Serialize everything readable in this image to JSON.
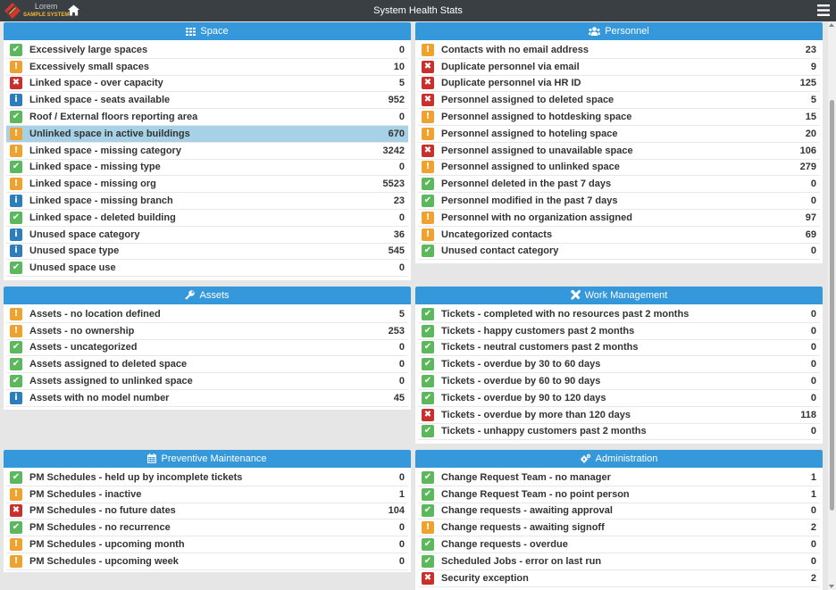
{
  "header": {
    "logo_line1": "Lorem",
    "logo_line2": "SAMPLE SYSTEM",
    "title": "System Health Stats"
  },
  "colors": {
    "ok": "#5cb85c",
    "warn": "#f0a22e",
    "err": "#c9302c",
    "info": "#2b7dbc",
    "panel_header": "#3498db",
    "topbar": "#3a3f44",
    "highlight": "#a7d1e6"
  },
  "panels": {
    "space": {
      "title": "Space",
      "icon": "grid-icon",
      "rows": [
        {
          "label": "Excessively large spaces",
          "value": "0",
          "status": "ok"
        },
        {
          "label": "Excessively small spaces",
          "value": "10",
          "status": "warn"
        },
        {
          "label": "Linked space - over capacity",
          "value": "5",
          "status": "err"
        },
        {
          "label": "Linked space - seats available",
          "value": "952",
          "status": "info"
        },
        {
          "label": "Roof / External floors reporting area",
          "value": "0",
          "status": "ok"
        },
        {
          "label": "Unlinked space in active buildings",
          "value": "670",
          "status": "warn"
        },
        {
          "label": "Linked space - missing category",
          "value": "3242",
          "status": "warn"
        },
        {
          "label": "Linked space - missing type",
          "value": "0",
          "status": "ok"
        },
        {
          "label": "Linked space - missing org",
          "value": "5523",
          "status": "warn"
        },
        {
          "label": "Linked space - missing branch",
          "value": "23",
          "status": "info"
        },
        {
          "label": "Linked space - deleted building",
          "value": "0",
          "status": "ok"
        },
        {
          "label": "Unused space category",
          "value": "36",
          "status": "info"
        },
        {
          "label": "Unused space type",
          "value": "545",
          "status": "info"
        },
        {
          "label": "Unused space use",
          "value": "0",
          "status": "ok"
        }
      ]
    },
    "personnel": {
      "title": "Personnel",
      "icon": "users-icon",
      "rows": [
        {
          "label": "Contacts with no email address",
          "value": "23",
          "status": "warn"
        },
        {
          "label": "Duplicate personnel via email",
          "value": "9",
          "status": "err"
        },
        {
          "label": "Duplicate personnel via HR ID",
          "value": "125",
          "status": "err"
        },
        {
          "label": "Personnel assigned to deleted space",
          "value": "5",
          "status": "err"
        },
        {
          "label": "Personnel assigned to hotdesking space",
          "value": "15",
          "status": "warn"
        },
        {
          "label": "Personnel assigned to hoteling space",
          "value": "20",
          "status": "warn"
        },
        {
          "label": "Personnel assigned to unavailable space",
          "value": "106",
          "status": "err"
        },
        {
          "label": "Personnel assigned to unlinked space",
          "value": "279",
          "status": "warn"
        },
        {
          "label": "Personnel deleted in the past 7 days",
          "value": "0",
          "status": "ok"
        },
        {
          "label": "Personnel modified in the past 7 days",
          "value": "0",
          "status": "ok"
        },
        {
          "label": "Personnel with no organization assigned",
          "value": "97",
          "status": "warn"
        },
        {
          "label": "Uncategorized contacts",
          "value": "69",
          "status": "warn"
        },
        {
          "label": "Unused contact category",
          "value": "0",
          "status": "ok"
        }
      ]
    },
    "assets": {
      "title": "Assets",
      "icon": "wrench-icon",
      "rows": [
        {
          "label": "Assets - no location defined",
          "value": "5",
          "status": "warn"
        },
        {
          "label": "Assets - no ownership",
          "value": "253",
          "status": "warn"
        },
        {
          "label": "Assets - uncategorized",
          "value": "0",
          "status": "ok"
        },
        {
          "label": "Assets assigned to deleted space",
          "value": "0",
          "status": "ok"
        },
        {
          "label": "Assets assigned to unlinked space",
          "value": "0",
          "status": "ok"
        },
        {
          "label": "Assets with no model number",
          "value": "45",
          "status": "info"
        }
      ]
    },
    "work": {
      "title": "Work Management",
      "icon": "tools-icon",
      "rows": [
        {
          "label": "Tickets - completed with no resources past 2 months",
          "value": "0",
          "status": "ok"
        },
        {
          "label": "Tickets - happy customers past 2 months",
          "value": "0",
          "status": "ok"
        },
        {
          "label": "Tickets - neutral customers past 2 months",
          "value": "0",
          "status": "ok"
        },
        {
          "label": "Tickets - overdue by 30 to 60 days",
          "value": "0",
          "status": "ok"
        },
        {
          "label": "Tickets - overdue by 60 to 90 days",
          "value": "0",
          "status": "ok"
        },
        {
          "label": "Tickets - overdue by 90 to 120 days",
          "value": "0",
          "status": "ok"
        },
        {
          "label": "Tickets - overdue by more than 120 days",
          "value": "118",
          "status": "err"
        },
        {
          "label": "Tickets - unhappy customers past 2 months",
          "value": "0",
          "status": "ok"
        }
      ]
    },
    "pm": {
      "title": "Preventive Maintenance",
      "icon": "calendar-icon",
      "rows": [
        {
          "label": "PM Schedules - held up by incomplete tickets",
          "value": "0",
          "status": "ok"
        },
        {
          "label": "PM Schedules - inactive",
          "value": "1",
          "status": "warn"
        },
        {
          "label": "PM Schedules - no future dates",
          "value": "104",
          "status": "err"
        },
        {
          "label": "PM Schedules - no recurrence",
          "value": "0",
          "status": "ok"
        },
        {
          "label": "PM Schedules - upcoming month",
          "value": "0",
          "status": "warn"
        },
        {
          "label": "PM Schedules - upcoming week",
          "value": "0",
          "status": "warn"
        }
      ]
    },
    "admin": {
      "title": "Administration",
      "icon": "cogs-icon",
      "rows": [
        {
          "label": "Change Request Team - no manager",
          "value": "1",
          "status": "ok"
        },
        {
          "label": "Change Request Team - no point person",
          "value": "1",
          "status": "ok"
        },
        {
          "label": "Change requests - awaiting approval",
          "value": "0",
          "status": "ok"
        },
        {
          "label": "Change requests - awaiting signoff",
          "value": "2",
          "status": "warn"
        },
        {
          "label": "Change requests - overdue",
          "value": "0",
          "status": "ok"
        },
        {
          "label": "Scheduled Jobs - error on last run",
          "value": "0",
          "status": "ok"
        },
        {
          "label": "Security exception",
          "value": "2",
          "status": "err"
        }
      ]
    }
  }
}
